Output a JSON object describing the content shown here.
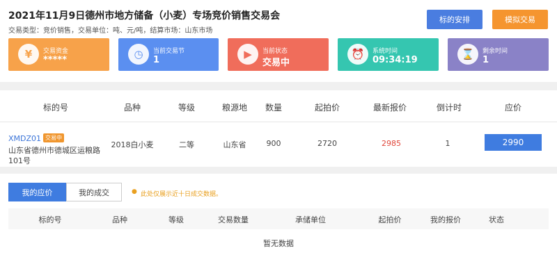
{
  "header": {
    "title": "2021年11月9日德州市地方储备（小麦）专场竞价销售交易会",
    "subtitle": "交易类型：竞价销售，交易单位：吨、元/吨，结算市场：山东市场",
    "schedule_button": "标的安排",
    "simulate_button": "模拟交易"
  },
  "cards": [
    {
      "label": "交易资金",
      "value": "*****",
      "icon": "money-bag-icon"
    },
    {
      "label": "当前交易节",
      "value": "1",
      "icon": "stopwatch-icon"
    },
    {
      "label": "当前状态",
      "value": "交易中",
      "icon": "play-icon"
    },
    {
      "label": "系统时间",
      "value": "09:34:19",
      "icon": "alarm-clock-icon"
    },
    {
      "label": "剩余时间",
      "value": "1",
      "icon": "hourglass-icon"
    }
  ],
  "lot_table": {
    "headers": [
      "标的号",
      "品种",
      "等级",
      "粮源地",
      "数量",
      "起拍价",
      "最新报价",
      "倒计时",
      "应价"
    ],
    "row": {
      "code": "XMDZ01",
      "badge": "交易中",
      "address": "山东省德州市德城区运粮路101号",
      "variety": "2018白小麦",
      "grade": "二等",
      "origin": "山东省",
      "quantity": "900",
      "start_price": "2720",
      "latest_price": "2985",
      "countdown": "1",
      "bid_price": "2990"
    },
    "colors": {
      "latest_price": "#e0463a",
      "accent": "#3f7ce0"
    }
  },
  "bids": {
    "tab_my_bids": "我的应价",
    "tab_my_deals": "我的成交",
    "notice": "此处仅展示近十日成交数据。",
    "headers": [
      "标的号",
      "品种",
      "等级",
      "交易数量",
      "承储单位",
      "起拍价",
      "我的报价",
      "状态"
    ],
    "empty_text": "暂无数据"
  }
}
